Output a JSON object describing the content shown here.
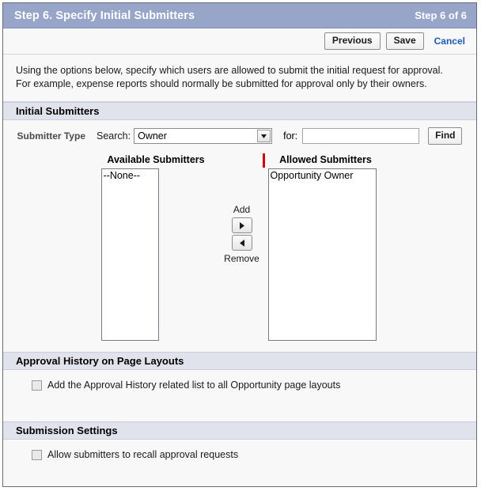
{
  "header": {
    "title": "Step 6. Specify Initial Submitters",
    "step_counter": "Step 6 of 6"
  },
  "toolbar": {
    "previous_label": "Previous",
    "save_label": "Save",
    "cancel_label": "Cancel"
  },
  "description": {
    "line1": "Using the options below, specify which users are allowed to submit the initial request for approval.",
    "line2": "For example, expense reports should normally be submitted for approval only by their owners."
  },
  "initial_submitters": {
    "section_title": "Initial Submitters",
    "field_label": "Submitter Type",
    "search_label": "Search:",
    "search_value": "Owner",
    "search_options": [
      "Owner"
    ],
    "for_label": "for:",
    "for_value": "",
    "for_placeholder": "",
    "find_label": "Find",
    "available_title": "Available Submitters",
    "available_options": [
      "--None--"
    ],
    "allowed_title": "Allowed Submitters",
    "allowed_options": [
      "Opportunity Owner"
    ],
    "add_label": "Add",
    "remove_label": "Remove"
  },
  "approval_history": {
    "section_title": "Approval History on Page Layouts",
    "checkbox_label": "Add the Approval History related list to all Opportunity page layouts",
    "checked": false
  },
  "submission_settings": {
    "section_title": "Submission Settings",
    "checkbox_label": "Allow submitters to recall approval requests",
    "checked": false
  },
  "colors": {
    "title_bar": "#96a5c8",
    "section_header": "#e0e3ec",
    "required_marker": "#cc0000",
    "link": "#1b5bb4"
  }
}
